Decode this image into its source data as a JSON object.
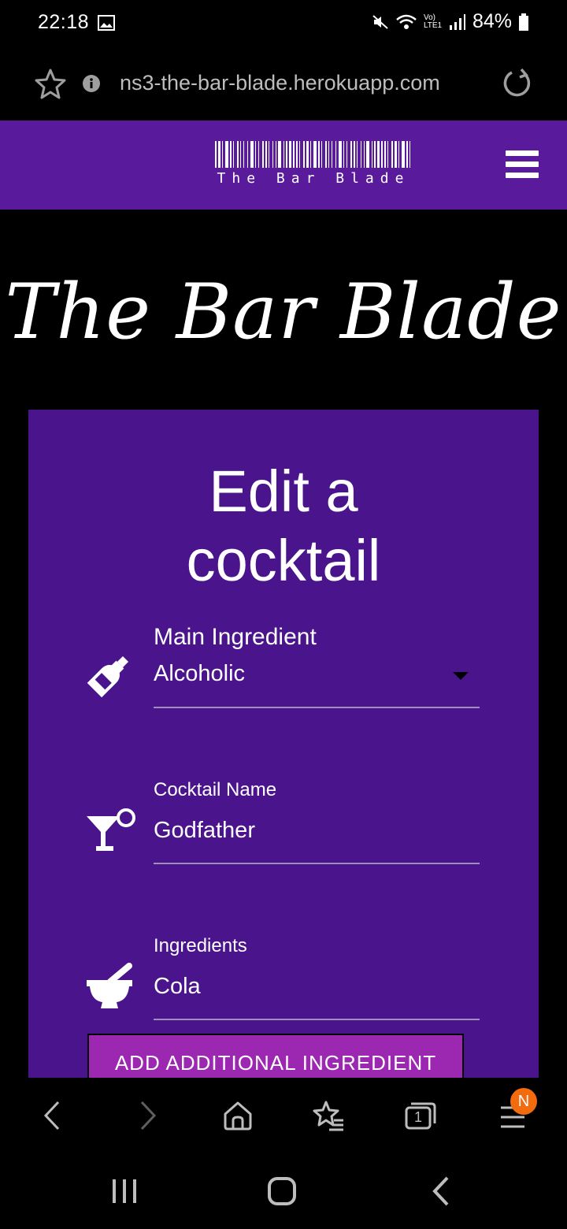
{
  "status_bar": {
    "time": "22:18",
    "battery": "84%",
    "network_label": "Vo) LTE1"
  },
  "browser": {
    "url": "ns3-the-bar-blade.herokuapp.com"
  },
  "navbar": {
    "brand_text": "The Bar Blade"
  },
  "hero": {
    "title": "The Bar Blade"
  },
  "form": {
    "title_line1": "Edit a",
    "title_line2": "cocktail",
    "main_ingredient": {
      "label": "Main Ingredient",
      "value": "Alcoholic"
    },
    "cocktail_name": {
      "label": "Cocktail Name",
      "value": "Godfather"
    },
    "ingredients": {
      "label": "Ingredients",
      "value": "Cola"
    },
    "add_button": "ADD ADDITIONAL INGREDIENT"
  },
  "browser_nav": {
    "tabs_count": "1",
    "menu_badge": "N"
  },
  "colors": {
    "navbar": "#5a1a9c",
    "card": "#4a148c",
    "button": "#9c27b0",
    "badge": "#f26b0f"
  }
}
